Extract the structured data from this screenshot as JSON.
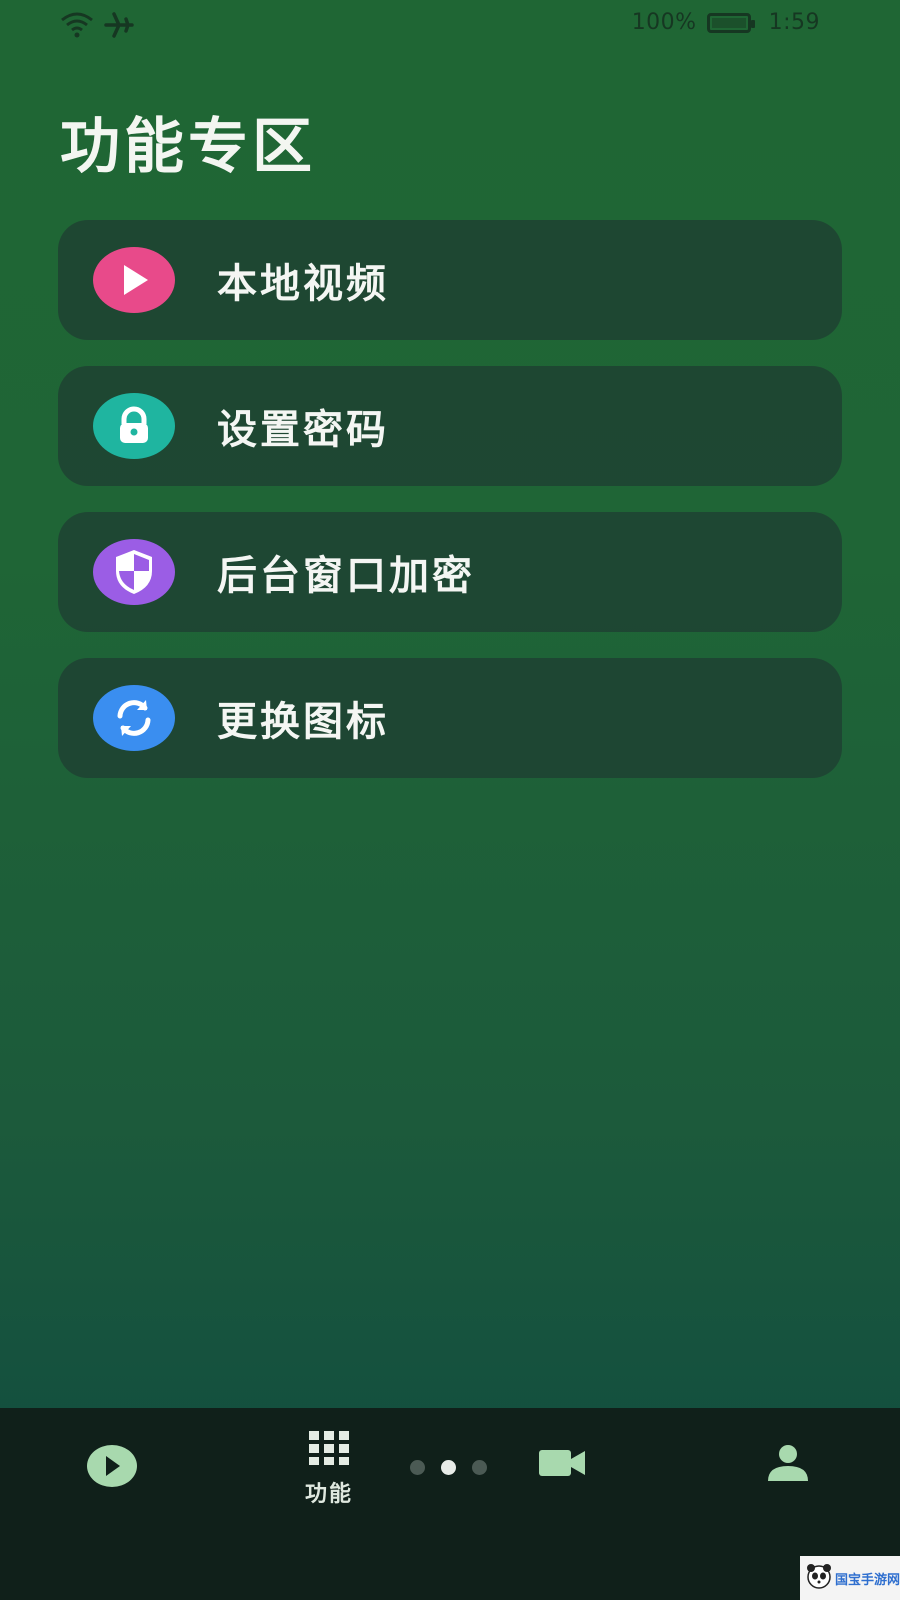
{
  "status_bar": {
    "battery_percent": "100%",
    "time": "1:59",
    "icons": [
      "wifi-icon",
      "airplane-icon",
      "battery-icon"
    ]
  },
  "page": {
    "title": "功能专区"
  },
  "features": [
    {
      "label": "本地视频",
      "icon": "play-icon",
      "color": "#e84a8a"
    },
    {
      "label": "设置密码",
      "icon": "lock-icon",
      "color": "#1fb5a0"
    },
    {
      "label": "后台窗口加密",
      "icon": "shield-icon",
      "color": "#9b5de5"
    },
    {
      "label": "更换图标",
      "icon": "refresh-icon",
      "color": "#3a8ef0"
    }
  ],
  "bottom_nav": {
    "items": [
      {
        "icon": "play-circle-icon",
        "label": ""
      },
      {
        "icon": "grid-icon",
        "label": "功能"
      },
      {
        "icon": "video-camera-icon",
        "label": ""
      },
      {
        "icon": "person-icon",
        "label": ""
      }
    ],
    "page_indicator": {
      "count": 3,
      "active_index": 1
    },
    "accent_color": "#a8d9ae"
  },
  "watermark": {
    "text": "国宝手游网"
  }
}
